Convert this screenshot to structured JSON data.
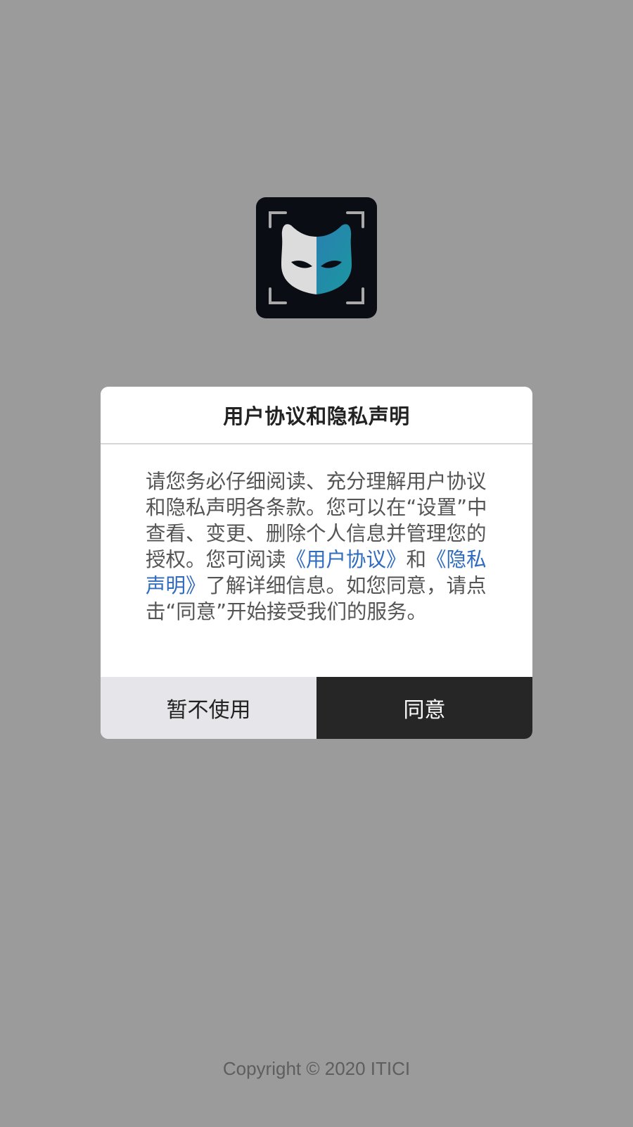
{
  "colors": {
    "overlay": "#9b9b9b",
    "link": "#2f6bbf",
    "primary_button": "#262626",
    "secondary_button": "#e6e6ea",
    "icon_background": "#0a0d14",
    "icon_teal": "#1e8fa3"
  },
  "app_icon": {
    "icon": "cat-mask-icon"
  },
  "dialog": {
    "title": "用户协议和隐私声明",
    "body": {
      "text_before": "请您务必仔细阅读、充分理解用户协议和隐私声明各条款。您可以在“设置”中查看、变更、删除个人信息并管理您的授权。您可阅读",
      "link_user_agreement": "《用户协议》",
      "text_and": "和",
      "link_privacy_statement": "《隐私声明》",
      "text_after": "了解详细信息。如您同意，请点击“同意”开始接受我们的服务。"
    },
    "decline_label": "暂不使用",
    "agree_label": "同意"
  },
  "footer": {
    "copyright": "Copyright © 2020 ITICI"
  }
}
